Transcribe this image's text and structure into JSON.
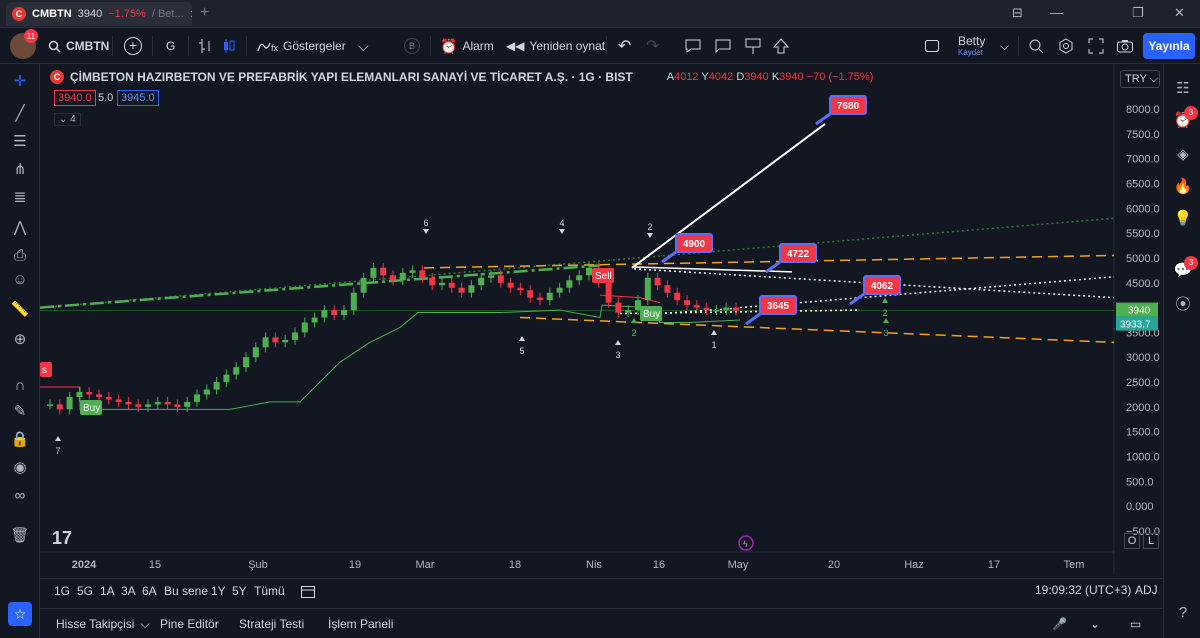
{
  "tab": {
    "logo_letter": "C",
    "ticker": "CMBTN",
    "price": "3940",
    "change": "−1.75%",
    "suffix": "/ Bet...",
    "close": "✕",
    "new_tab": "+"
  },
  "window_controls": [
    "⊟",
    "—",
    "❐",
    "✕"
  ],
  "toolbar": {
    "avatar_badge": "11",
    "symbol": "CMBTN",
    "add_symbol": "+",
    "interval": "G",
    "indicators_label": "Göstergeler",
    "b_badge": "B",
    "alarm_label": "Alarm",
    "replay_label": "Yeniden oynat",
    "layout_name": "Betty",
    "layout_sub": "Kaydet",
    "publish_label": "Yayınla"
  },
  "legend": {
    "logo_letter": "C",
    "name": "ÇİMBETON HAZIRBETON VE PREFABRİK YAPI ELEMANLARI SANAYİ VE TİCARET A.Ş. · 1G · BIST",
    "open_label": "A",
    "open": "4012",
    "high_label": "Y",
    "high": "4042",
    "low_label": "D",
    "low": "3940",
    "close_label": "K",
    "close": "3940",
    "change": "−70 (−1.75%)",
    "sell_price": "3940.0",
    "spread": "5.0",
    "buy_price": "3945.0",
    "collapse_count": "4",
    "currency": "TRY"
  },
  "chart_data": {
    "type": "candlestick",
    "x_axis_labels": [
      "2024",
      "15",
      "Şub",
      "19",
      "Mar",
      "18",
      "Nis",
      "16",
      "May",
      "20",
      "Haz",
      "17",
      "Tem"
    ],
    "y_axis_labels": [
      "8000.0",
      "7500.0",
      "7000.0",
      "6500.0",
      "6000.0",
      "5500.0",
      "5000.0",
      "4500.0",
      "3500.0",
      "3000.0",
      "2500.0",
      "2000.0",
      "1500.0",
      "1000.0",
      "500.0",
      "0.000",
      "−500.0"
    ],
    "ylim": [
      -600,
      8600
    ],
    "last_price_label": "3940",
    "last_price_label_2": "3933.7",
    "price_callouts": [
      "7680",
      "4900",
      "4722",
      "4062",
      "3645"
    ],
    "signal_labels": [
      "Buy",
      "Sell",
      "Buy",
      "Sell"
    ],
    "wave_labels": [
      "7",
      "6",
      "5",
      "4",
      "3",
      "2",
      "2",
      "1",
      "2",
      "3"
    ],
    "candles_approx_close": [
      2050,
      1950,
      2200,
      2300,
      2250,
      2200,
      2150,
      2100,
      2050,
      2000,
      2050,
      2100,
      2050,
      2000,
      2100,
      2250,
      2350,
      2500,
      2650,
      2800,
      3000,
      3200,
      3400,
      3300,
      3350,
      3500,
      3700,
      3800,
      3950,
      3850,
      3950,
      4300,
      4600,
      4800,
      4650,
      4550,
      4700,
      4750,
      4600,
      4450,
      4500,
      4400,
      4300,
      4450,
      4600,
      4650,
      4500,
      4400,
      4350,
      4200,
      4150,
      4300,
      4400,
      4550,
      4650,
      4800,
      4500,
      4100,
      3900,
      3950,
      4150,
      4600,
      4450,
      4300,
      4150,
      4050,
      4000,
      3950,
      3950,
      4000,
      3940
    ]
  },
  "bottom": {
    "ranges": [
      "1G",
      "5G",
      "1A",
      "3A",
      "6A",
      "Bu sene",
      "1Y",
      "5Y",
      "Tümü"
    ],
    "clock": "19:09:32 (UTC+3)",
    "adj": "ADJ",
    "log_btn": "O",
    "lock_btn": "L"
  },
  "panels": {
    "screener": "Hisse Takipçisi",
    "pine": "Pine Editör",
    "strategy": "Strateji Testi",
    "trading": "İşlem Paneli"
  },
  "right_badges": [
    "3",
    "3"
  ],
  "colors": {
    "background": "#131722",
    "up": "#4caf50",
    "down": "#f23645",
    "accent": "#2962ff",
    "trend_orange": "#f7a21b"
  }
}
